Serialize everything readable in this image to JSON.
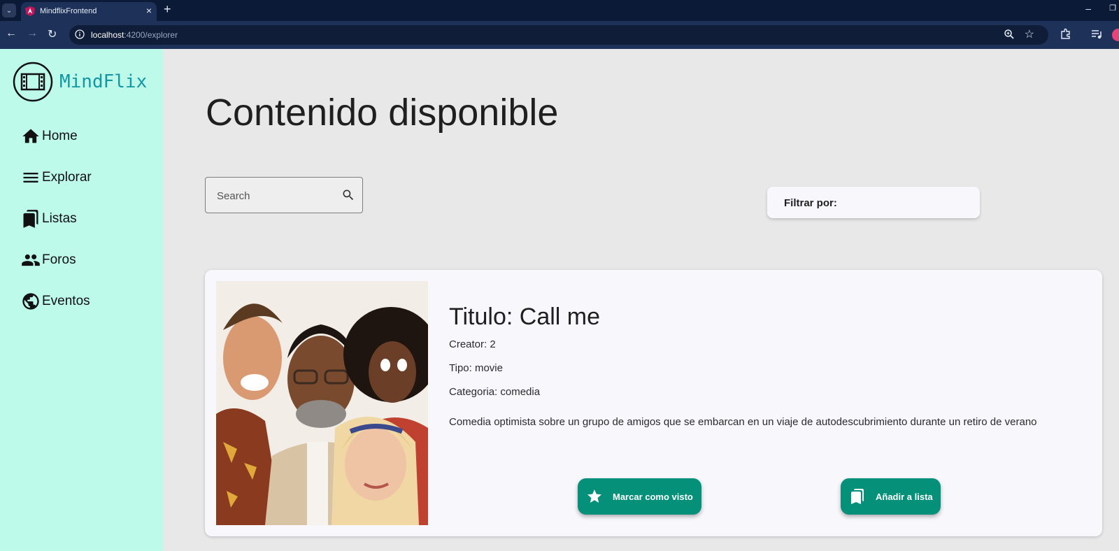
{
  "browser": {
    "tab_title": "MindflixFrontend",
    "url_host": "localhost",
    "url_path": ":4200/explorer"
  },
  "sidebar": {
    "brand": "MindFlix",
    "items": [
      {
        "label": "Home",
        "icon": "home-icon"
      },
      {
        "label": "Explorar",
        "icon": "menu-icon"
      },
      {
        "label": "Listas",
        "icon": "bookmarks-icon"
      },
      {
        "label": "Foros",
        "icon": "people-icon"
      },
      {
        "label": "Eventos",
        "icon": "globe-icon"
      }
    ]
  },
  "main": {
    "title": "Contenido disponible",
    "search": {
      "placeholder": "Search"
    },
    "filter": {
      "label": "Filtrar por:"
    }
  },
  "content_card": {
    "title": "Titulo: Call me",
    "creator": "Creator: 2",
    "type": "Tipo: movie",
    "category": "Categoria: comedia",
    "description": "Comedia optimista sobre un grupo de amigos que se embarcan en un viaje de autodescubrimiento durante un retiro de verano",
    "mark_seen_label": "Marcar como visto",
    "add_list_label": "Añadir a lista"
  },
  "colors": {
    "sidebar_bg": "#bdfaea",
    "accent": "#05907a",
    "brand_text": "#1397a3",
    "page_bg": "#e8e8e8"
  }
}
